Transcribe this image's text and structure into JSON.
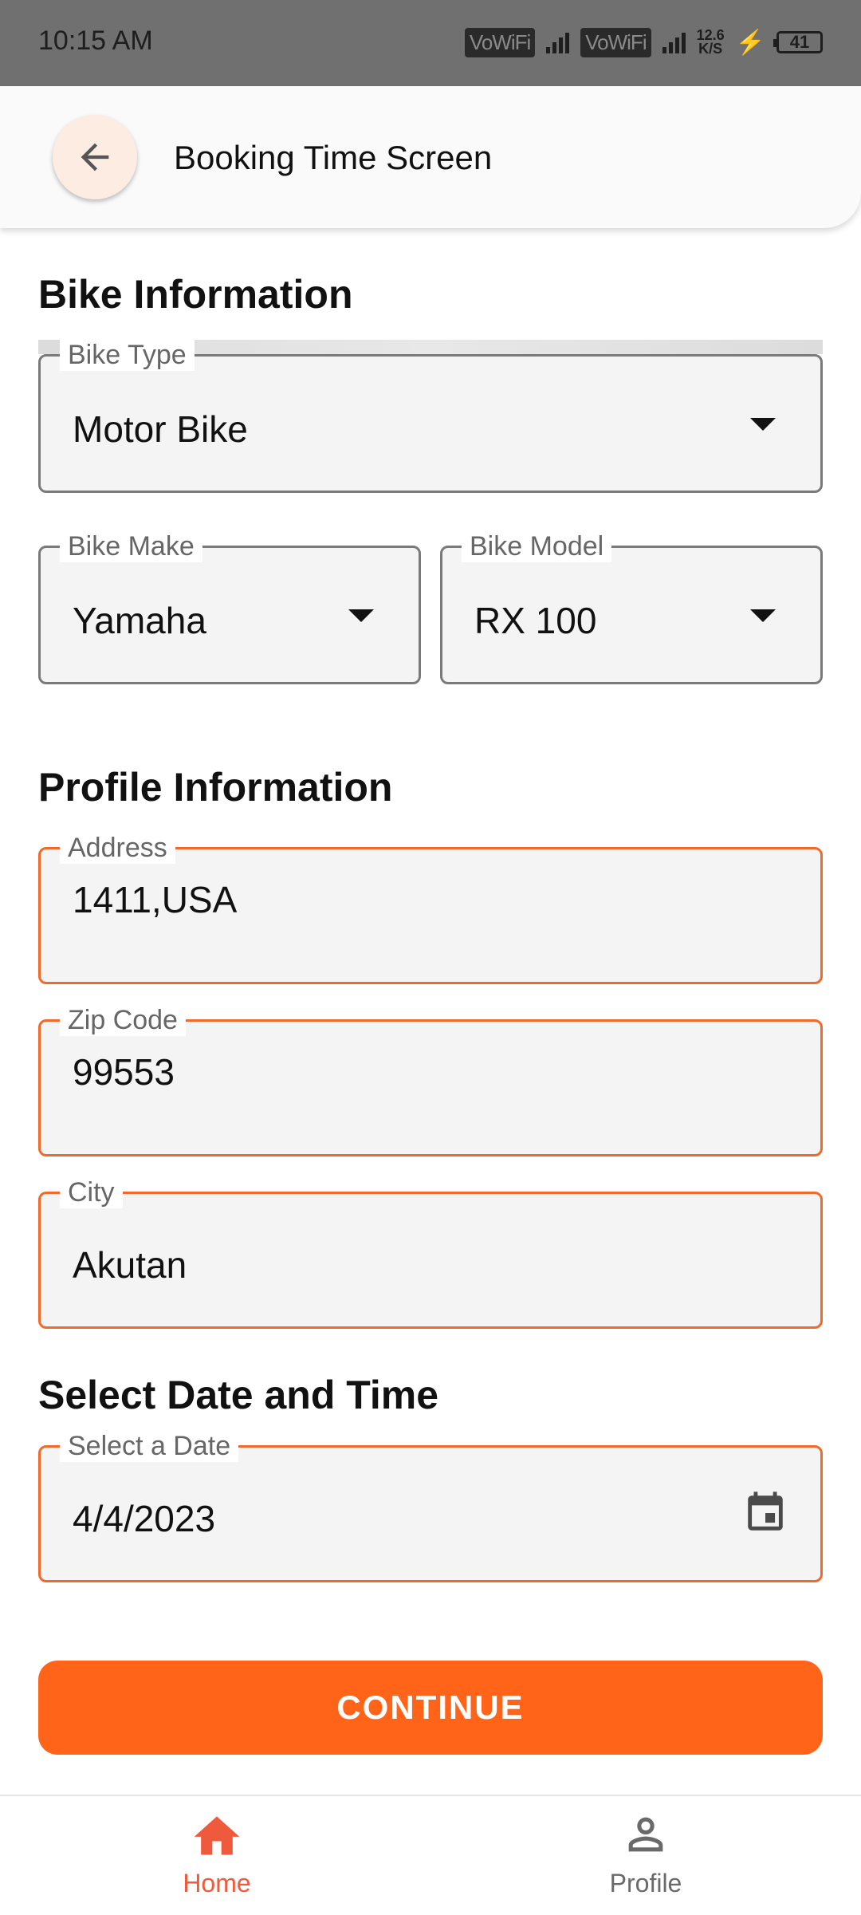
{
  "status_bar": {
    "time": "10:15 AM",
    "network_1": "VoWiFi",
    "network_2": "VoWiFi",
    "speed_value": "12.6",
    "speed_unit": "K/S",
    "battery": "41"
  },
  "app_bar": {
    "title": "Booking Time Screen"
  },
  "bike_section": {
    "title": "Bike Information",
    "bike_type": {
      "label": "Bike Type",
      "value": "Motor Bike"
    },
    "bike_make": {
      "label": "Bike Make",
      "value": "Yamaha"
    },
    "bike_model": {
      "label": "Bike Model",
      "value": "RX 100"
    }
  },
  "profile_section": {
    "title": "Profile Information",
    "address": {
      "label": "Address",
      "value": "1411,USA"
    },
    "zip": {
      "label": "Zip Code",
      "value": "99553"
    },
    "city": {
      "label": "City",
      "value": "Akutan"
    }
  },
  "datetime_section": {
    "title": "Select Date and Time",
    "date": {
      "label": "Select a Date",
      "value": "4/4/2023"
    }
  },
  "continue_button": "CONTINUE",
  "bottom_nav": {
    "home": "Home",
    "profile": "Profile"
  },
  "colors": {
    "accent": "#ff6419",
    "field_border_active": "#ef6a2b",
    "nav_active": "#f05a3c"
  }
}
